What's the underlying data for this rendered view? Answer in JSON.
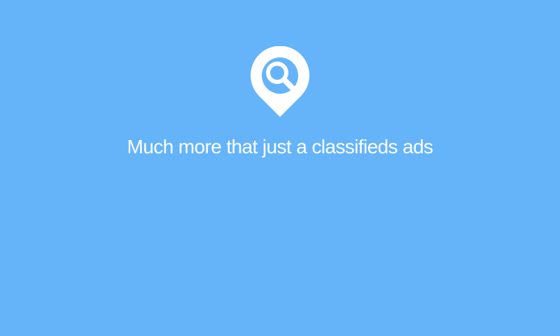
{
  "splash": {
    "logo_icon": "location-pin-search-icon",
    "tagline": "Much more that just a classifieds ads"
  },
  "colors": {
    "background": "#65b4fa",
    "foreground": "#ffffff"
  }
}
